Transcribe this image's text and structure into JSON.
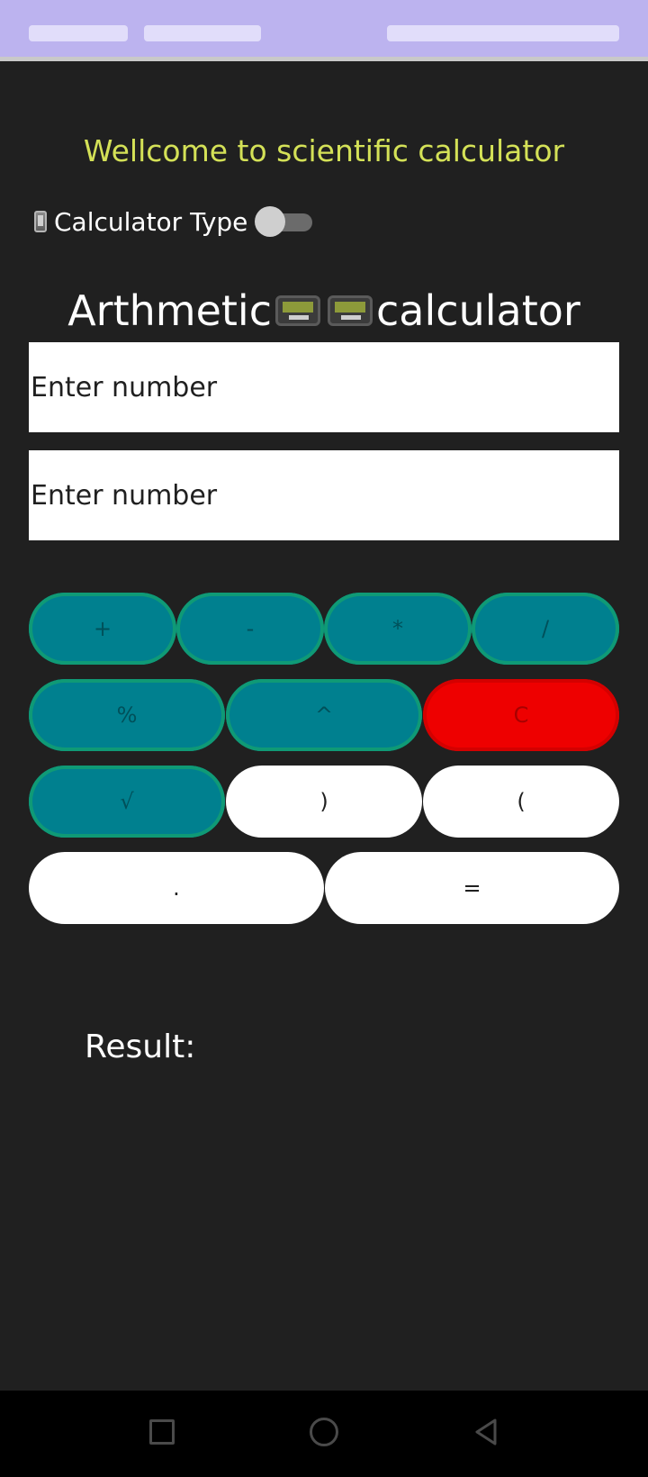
{
  "header": {
    "welcome": "Wellcome to scientific calculator",
    "calculator_type_label": "Calculator Type",
    "calculator_type_on": false,
    "title_left": "Arthmetic",
    "title_right": "calculator"
  },
  "inputs": [
    {
      "placeholder": "Enter number",
      "value": ""
    },
    {
      "placeholder": "Enter number",
      "value": ""
    }
  ],
  "buttons": {
    "row1": [
      "+",
      "-",
      "*",
      "/"
    ],
    "row2": [
      "%",
      "^",
      "C"
    ],
    "row3": [
      "√",
      ")",
      "("
    ],
    "row4": [
      ".",
      "="
    ]
  },
  "result_label": "Result:",
  "colors": {
    "background": "#202020",
    "status_bar": "#bcb3ef",
    "welcome_text": "#d4e157",
    "teal_button": "#00808f",
    "red_button": "#ee0000",
    "white_button": "#ffffff"
  },
  "icons": [
    "phone-icon",
    "pager-icon",
    "square-nav-icon",
    "circle-nav-icon",
    "back-nav-icon"
  ]
}
